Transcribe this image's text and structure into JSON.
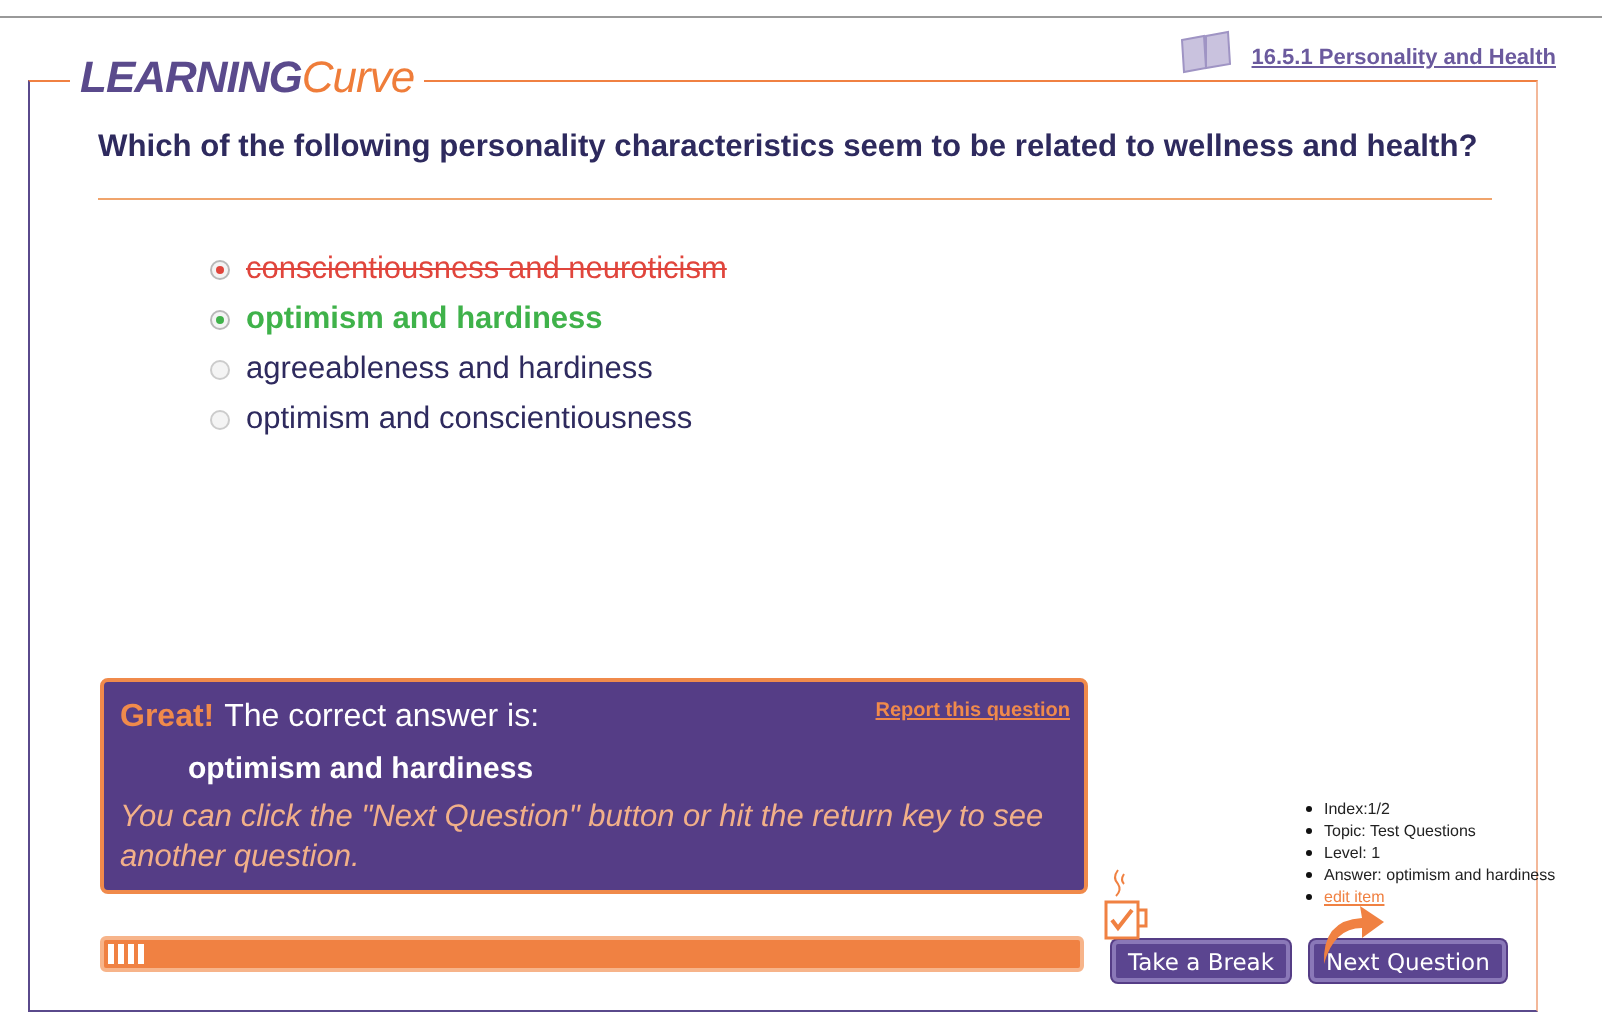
{
  "header": {
    "logo_bold": "LEARNING",
    "logo_light": "Curve",
    "topic_link": "16.5.1 Personality and Health"
  },
  "question": "Which of the following personality characteristics seem to be related to wellness and health?",
  "options": [
    {
      "label": "conscientiousness and neuroticism",
      "selected": true,
      "kind": "wrong"
    },
    {
      "label": "optimism and hardiness",
      "selected": true,
      "kind": "correct"
    },
    {
      "label": "agreeableness and hardiness",
      "selected": false,
      "kind": "plain"
    },
    {
      "label": "optimism and conscientiousness",
      "selected": false,
      "kind": "plain"
    }
  ],
  "feedback": {
    "exclaim": "Great!",
    "heading": "The correct answer is:",
    "answer": "optimism and hardiness",
    "hint": "You can click the \"Next Question\" button or hit the return key to see another question.",
    "report_link": "Report this question"
  },
  "progress": {
    "level": 0.04
  },
  "info": [
    {
      "kind": "text",
      "text": "Index:1/2"
    },
    {
      "kind": "text",
      "text": "Topic: Test Questions"
    },
    {
      "kind": "text",
      "text": "Level: 1"
    },
    {
      "kind": "text",
      "text": "Answer: optimism and hardiness"
    },
    {
      "kind": "link",
      "text": "edit item"
    }
  ],
  "buttons": {
    "break": "Take a Break",
    "next": "Next Question"
  }
}
